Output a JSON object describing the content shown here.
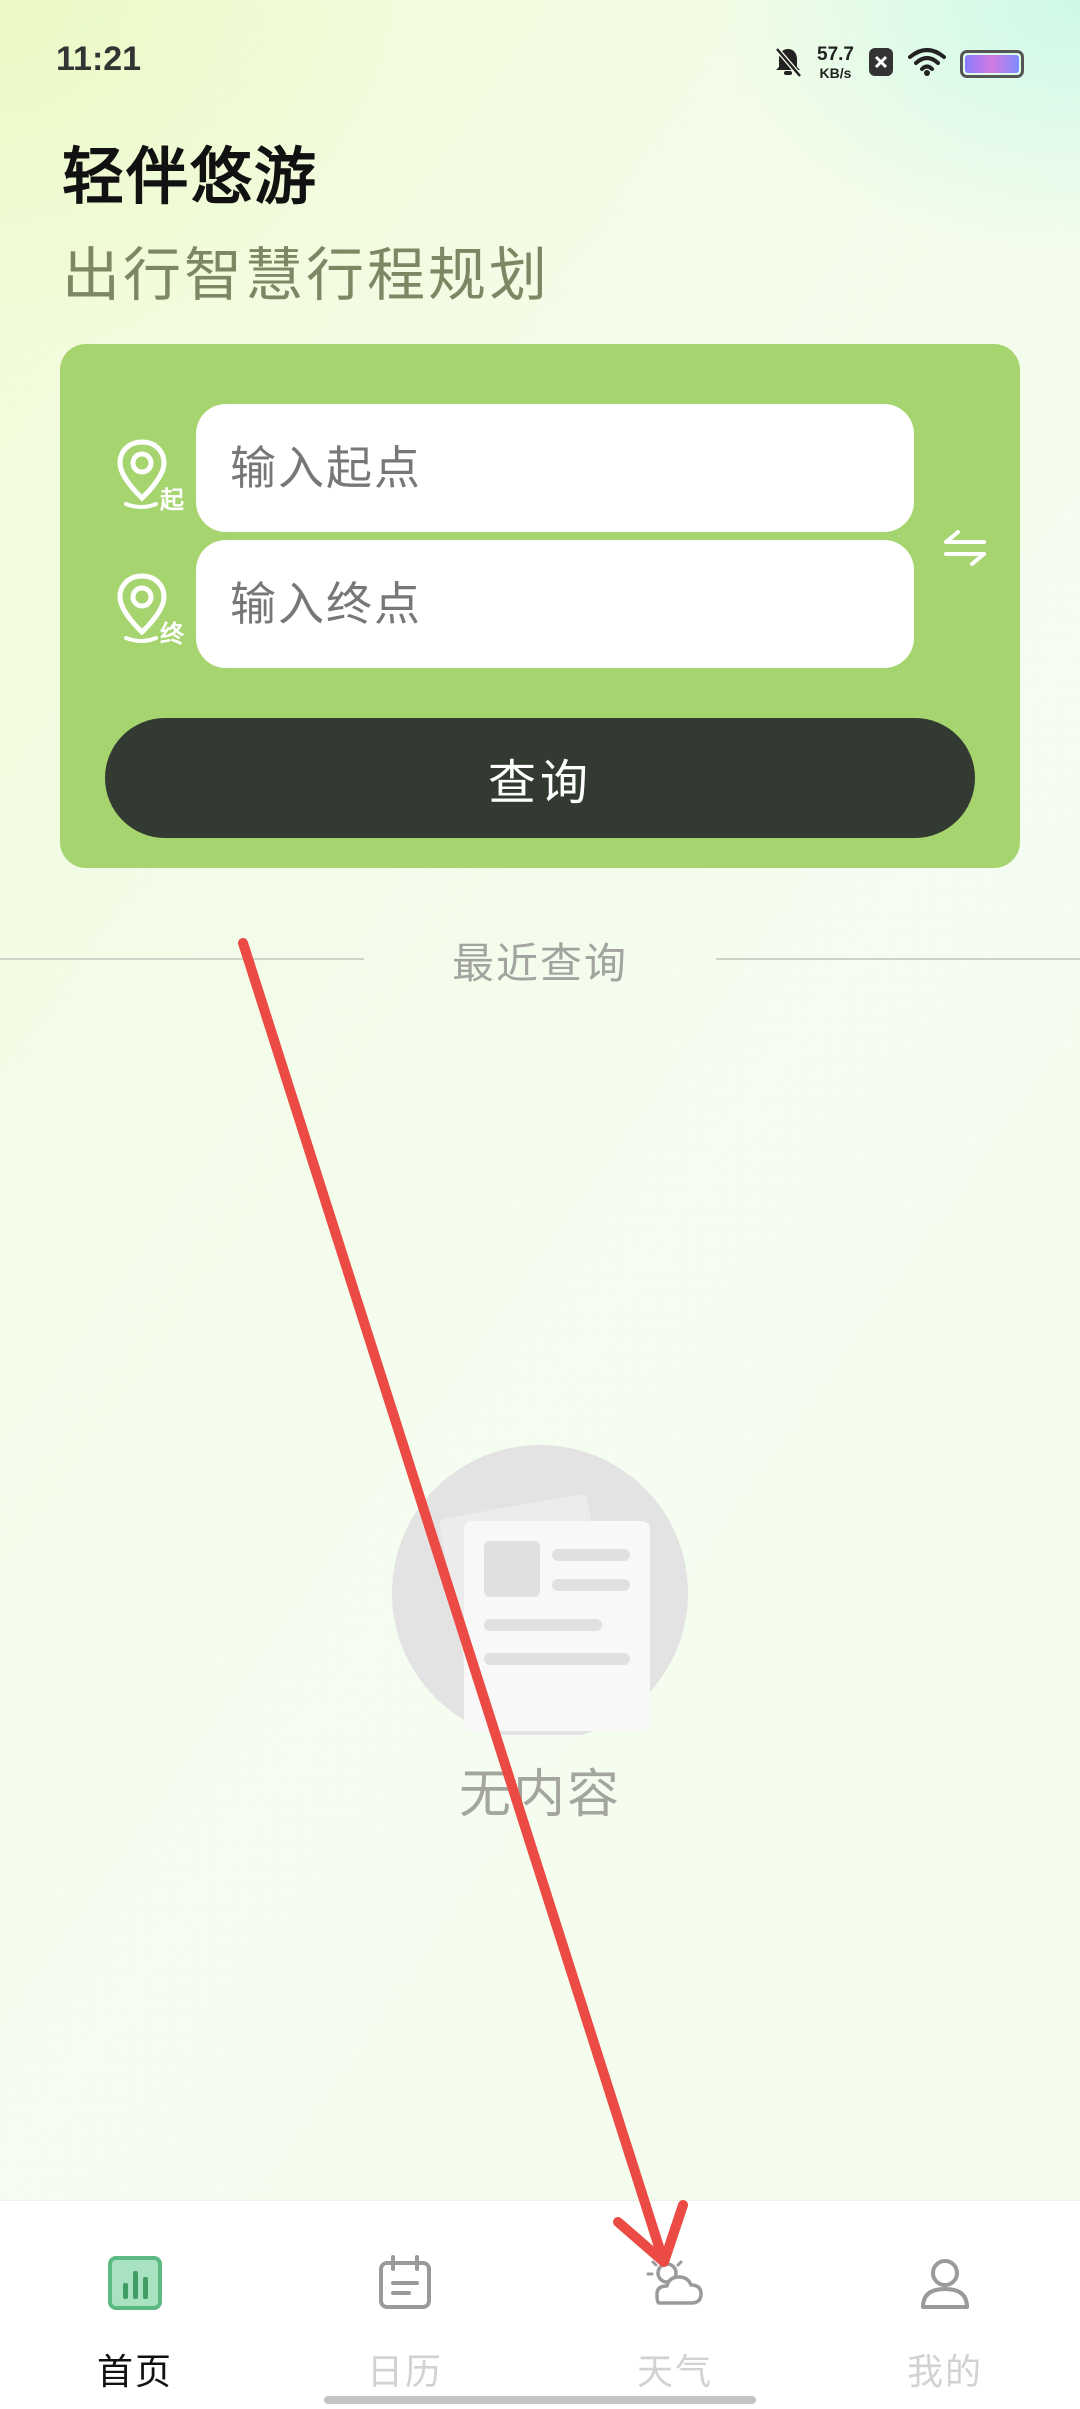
{
  "status_bar": {
    "time": "11:21",
    "net_speed_value": "57.7",
    "net_speed_unit": "KB/s",
    "icons": [
      "mute-bell-icon",
      "close-box-icon",
      "wifi-icon",
      "battery-icon"
    ]
  },
  "header": {
    "title": "轻伴悠游",
    "subtitle": "出行智慧行程规划"
  },
  "search": {
    "start_placeholder": "输入起点",
    "end_placeholder": "输入终点",
    "start_badge": "起",
    "end_badge": "终",
    "query_button_label": "查询"
  },
  "recent": {
    "label": "最近查询"
  },
  "empty_state": {
    "text": "无内容"
  },
  "nav": {
    "items": [
      {
        "label": "首页",
        "icon": "bar-chart-icon",
        "active": true
      },
      {
        "label": "日历",
        "icon": "calendar-icon",
        "active": false
      },
      {
        "label": "天气",
        "icon": "weather-icon",
        "active": false
      },
      {
        "label": "我的",
        "icon": "user-icon",
        "active": false
      }
    ]
  },
  "colors": {
    "card_green": "#a6d46f",
    "button_dark": "#323a31",
    "nav_active_icon": "#5aba82",
    "annotation_arrow": "#ec4b45"
  }
}
